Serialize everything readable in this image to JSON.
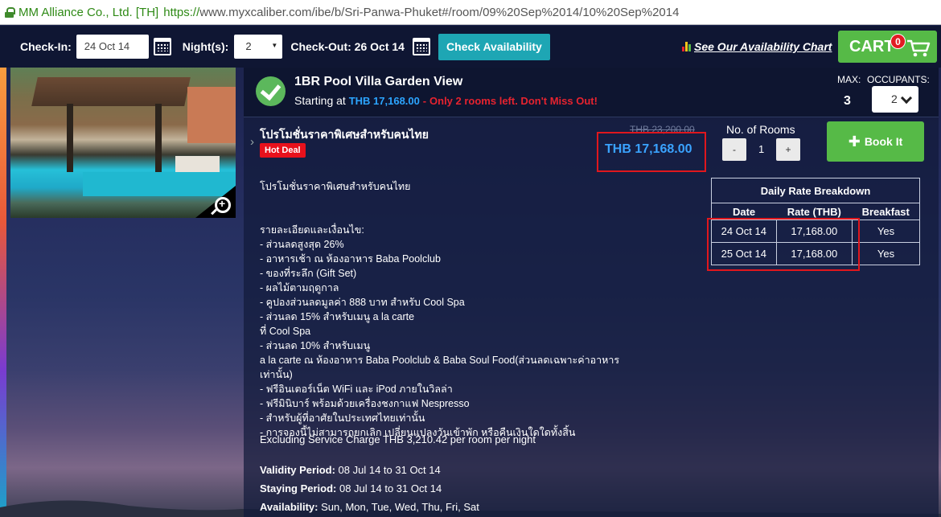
{
  "browser": {
    "ev_label": "MM Alliance Co., Ltd. [TH]",
    "url_scheme": "https://",
    "url_rest": "www.myxcaliber.com/ibe/b/Sri-Panwa-Phuket#/room/09%20Sep%2014/10%20Sep%2014"
  },
  "toolbar": {
    "checkin_label": "Check-In:",
    "checkin_value": "24 Oct 14",
    "nights_label": "Night(s):",
    "nights_value": "2",
    "checkout_label": "Check-Out: 26 Oct 14",
    "check_btn": "Check Availability",
    "chart_link": "See Our Availability Chart",
    "cart_label": "CART",
    "cart_count": "0"
  },
  "room": {
    "name": "1BR Pool Villa Garden View",
    "starting_at": "Starting at",
    "start_price": "THB 17,168.00",
    "dash": "-",
    "left_msg": "Only 2 rooms left. Don't Miss Out!",
    "max_label": "MAX:",
    "max_value": "3",
    "occupants_label": "OCCUPANTS:",
    "occupants_value": "2"
  },
  "offer": {
    "title": "โปรโมชั่นราคาพิเศษสำหรับคนไทย",
    "badge": "Hot Deal",
    "old_price": "THB 23,200.00",
    "price": "THB 17,168.00",
    "rooms_label": "No. of Rooms",
    "minus": "-",
    "rooms_value": "1",
    "plus": "+",
    "book_btn": "Book It"
  },
  "description": {
    "intro": "โปรโมชั่นราคาพิเศษสำหรับคนไทย",
    "terms_head": "รายละเอียดและเงื่อนไข:",
    "lines": [
      "- ส่วนลดสูงสุด 26%",
      "- อาหารเช้า ณ ห้องอาหาร Baba Poolclub",
      "- ของที่ระลึก (Gift Set)",
      "- ผลไม้ตามฤดูกาล",
      "- คูปองส่วนลดมูลค่า 888 บาท สำหรับ Cool Spa",
      "- ส่วนลด 15% สำหรับเมนู a la carte",
      "ที่ Cool Spa",
      "- ส่วนลด 10% สำหรับเมนู",
      "a la carte ณ ห้องอาหาร Baba Poolclub & Baba Soul Food(ส่วนลดเฉพาะค่าอาหาร",
      "เท่านั้น)",
      "- ฟรีอินเตอร์เน็ต WiFi และ iPod ภายในวิลล่า",
      "- ฟรีมินิบาร์ พร้อมด้วยเครื่องชงกาแฟ Nespresso",
      "- สำหรับผู้ที่อาศัยในประเทศไทยเท่านั้น",
      "- การจองนี้ไม่สามารถยกเลิก เปลี่ยนแปลงวันเข้าพัก หรือคืนเงินใดใดทั้งสิ้น"
    ],
    "service_note": "Excluding Service Charge THB 3,210.42 per room per night",
    "validity_label": "Validity Period:",
    "validity_value": "08 Jul 14 to 31 Oct 14",
    "staying_label": "Staying Period:",
    "staying_value": "08 Jul 14 to 31 Oct 14",
    "availability_label": "Availability:",
    "availability_value": "Sun, Mon, Tue, Wed, Thu, Fri, Sat"
  },
  "rate_table": {
    "caption": "Daily Rate Breakdown",
    "headers": [
      "Date",
      "Rate (THB)",
      "Breakfast"
    ],
    "rows": [
      [
        "24 Oct 14",
        "17,168.00",
        "Yes"
      ],
      [
        "25 Oct 14",
        "17,168.00",
        "Yes"
      ]
    ]
  },
  "colors": {
    "accent_green": "#56ba47",
    "accent_teal": "#1ea6b4",
    "price_blue": "#3aa3ff",
    "alert_red": "#e6232f"
  }
}
